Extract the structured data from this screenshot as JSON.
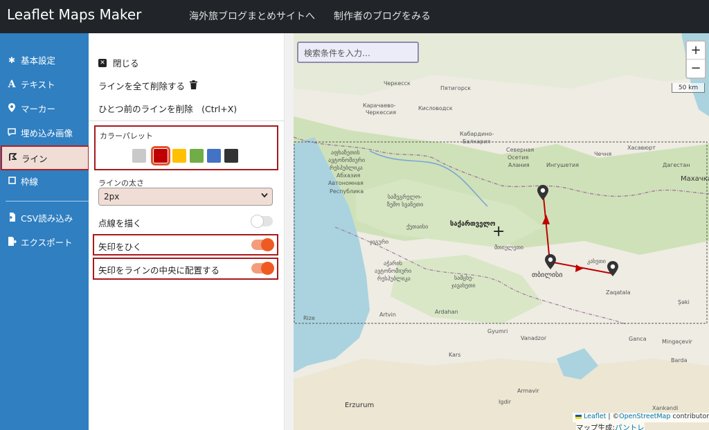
{
  "header": {
    "brand": "Leaflet Maps Maker",
    "nav_blog_summary": "海外旅ブログまとめサイトへ",
    "nav_author_blog": "制作者のブログをみる"
  },
  "sidebar": {
    "items": [
      {
        "label": "基本設定",
        "icon": "gear-icon"
      },
      {
        "label": "テキスト",
        "icon": "text-a-icon"
      },
      {
        "label": "マーカー",
        "icon": "map-pin-icon"
      },
      {
        "label": "埋め込み画像",
        "icon": "comment-icon"
      },
      {
        "label": "ライン",
        "icon": "route-icon",
        "active": true
      },
      {
        "label": "枠線",
        "icon": "square-icon"
      },
      {
        "label": "CSV読み込み",
        "icon": "file-import-icon"
      },
      {
        "label": "エクスポート",
        "icon": "export-icon"
      }
    ]
  },
  "panel": {
    "close_label": "閉じる",
    "delete_all_label": "ラインを全て削除する",
    "undo_label": "ひとつ前のラインを削除　(Ctrl+X)",
    "palette": {
      "label": "カラーパレット",
      "colors": [
        "#c9c9c9",
        "#c00000",
        "#ffc000",
        "#70ad47",
        "#4472c4",
        "#333333"
      ],
      "selected_index": 1
    },
    "width": {
      "label": "ラインの太さ",
      "value": "2px"
    },
    "toggles": [
      {
        "label": "点線を描く",
        "on": false
      },
      {
        "label": "矢印をひく",
        "on": true
      },
      {
        "label": "矢印をラインの中央に配置する",
        "on": true
      }
    ]
  },
  "map": {
    "search_placeholder": "検索条件を入力…",
    "zoom_in": "+",
    "zoom_out": "−",
    "scale": "50 km",
    "attribution_leaflet": "Leaflet",
    "attribution_sep": " | ©",
    "attribution_osm": "OpenStreetMap",
    "attribution_tail": " contributors",
    "made_by_prefix": "マップ生成:",
    "made_by_link": "パントレ",
    "line_color": "#c00000",
    "labels": [
      "Черкесск",
      "Пятигорск",
      "Карачаево-",
      "Черкессия",
      "Кисловодск",
      "Кабардино-",
      "Балкария",
      "Северная",
      "Осетия",
      "Алания",
      "Ингушетия",
      "Чечня",
      "Хасавюрт",
      "Дагестан",
      "Махачка",
      "აფხაზეთის",
      "ავტონომიური",
      "რესპუბლიკა",
      "Абхазия",
      "Автономная",
      "Республика",
      "სამეგრელო-",
      "ზემო სვანეთი",
      "ქუთაისი",
      "საქართველო",
      "მთიულეთი",
      "ჯიგური",
      "აჭარის",
      "ავტონომიური",
      "რესპუბლიკა",
      "სამცხე-",
      "ჯავახეთი",
      "თბილისი",
      "კახეთი",
      "Rize",
      "Artvin",
      "Ardahan",
      "Kars",
      "Gyumri",
      "Vanadzor",
      "Armavir",
      "Erzurum",
      "Igdir",
      "Şəki",
      "Ganca",
      "Mingəçevir",
      "Barda",
      "Xankəndi",
      "Zaqatala"
    ]
  }
}
